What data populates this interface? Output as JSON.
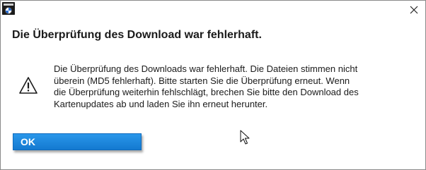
{
  "window": {
    "app_icon": "bmw-logo-icon",
    "close_icon": "close-icon"
  },
  "dialog": {
    "heading": "Die Überprüfung des Download war fehlerhaft.",
    "icon": "warning-icon",
    "message": "Die Überprüfung des Downloads war fehlerhaft. Die Dateien stimmen nicht\nüberein (MD5 fehlerhaft). Bitte starten Sie die Überprüfung erneut.  Wenn\ndie Überprüfung weiterhin fehlschlägt, brechen Sie bitte den Download des\nKartenupdates ab und laden Sie ihn erneut herunter.",
    "ok_label": "OK"
  },
  "colors": {
    "button_blue": "#1e88e0",
    "background": "#ffffff"
  }
}
